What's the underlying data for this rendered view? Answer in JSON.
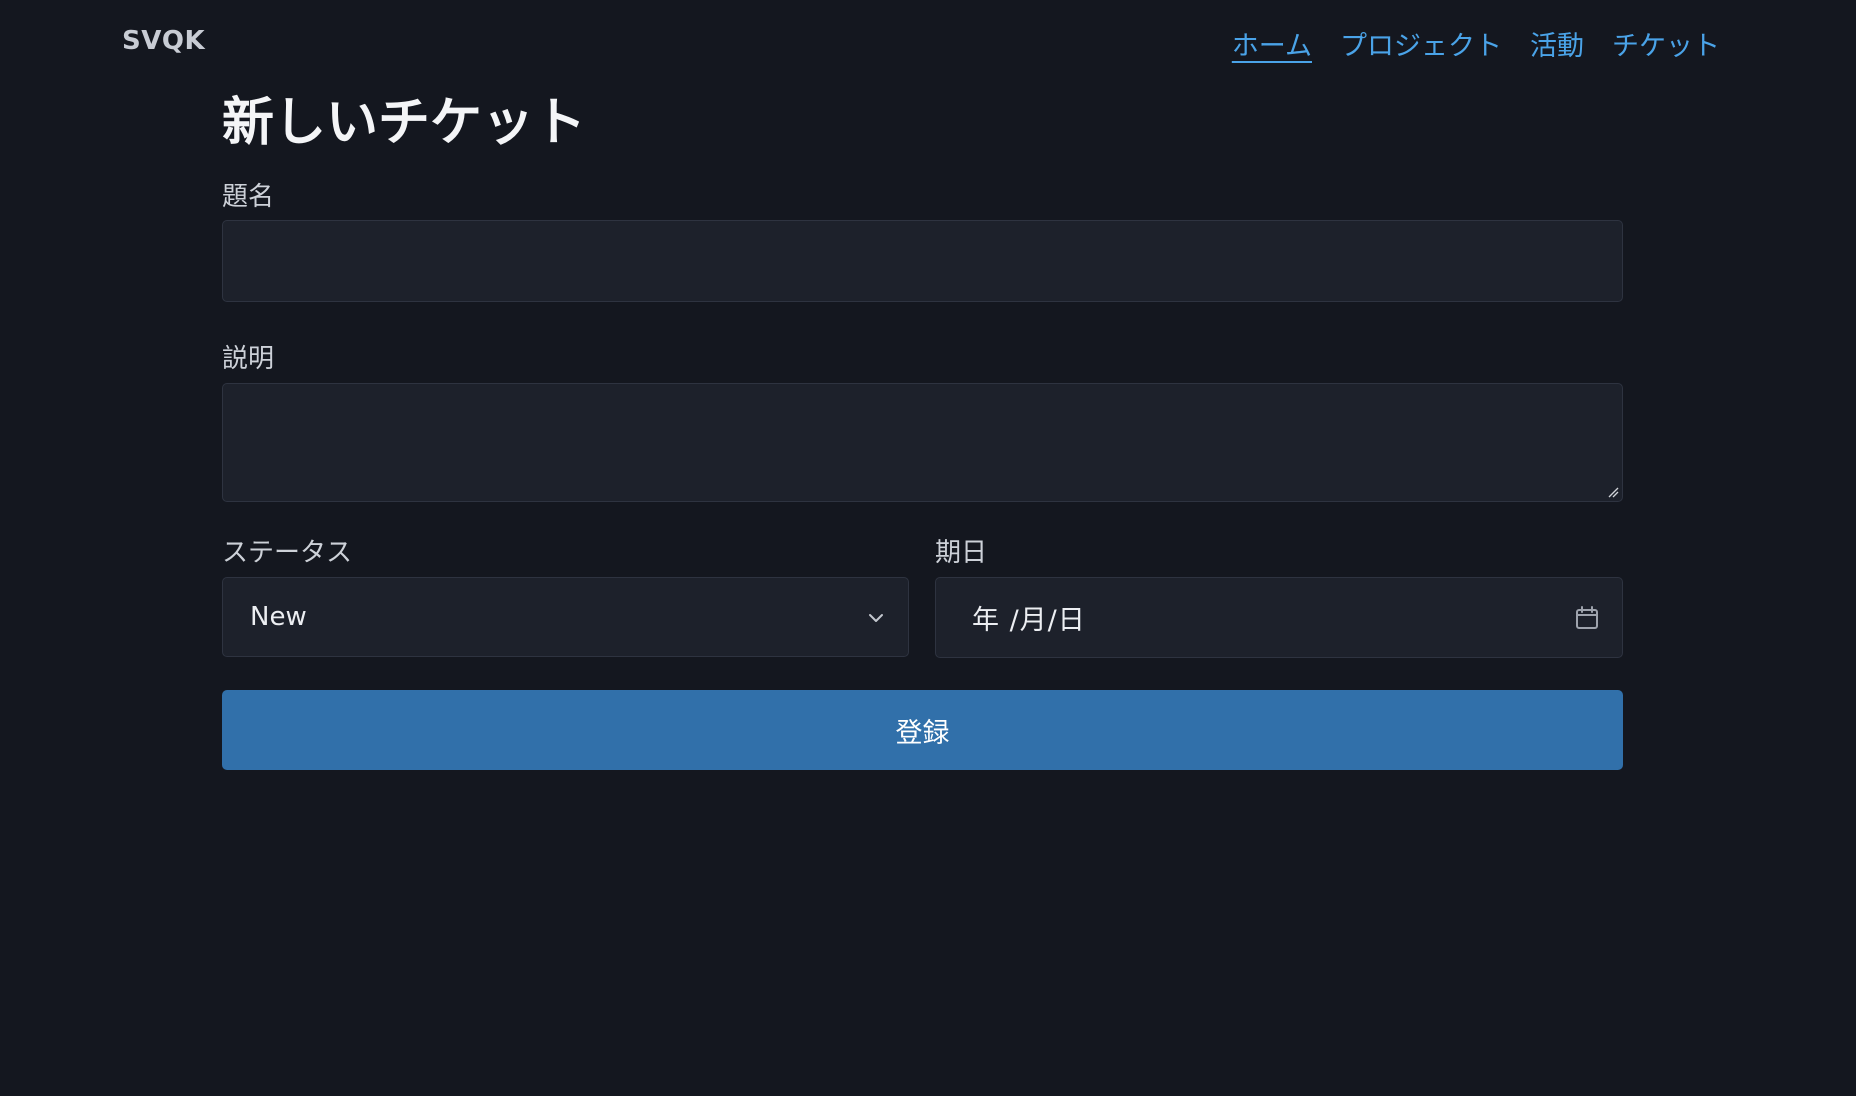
{
  "header": {
    "brand": "SVQK",
    "nav": [
      {
        "label": "ホーム",
        "active": true
      },
      {
        "label": "プロジェクト",
        "active": false
      },
      {
        "label": "活動",
        "active": false
      },
      {
        "label": "チケット",
        "active": false
      }
    ]
  },
  "page": {
    "title": "新しいチケット"
  },
  "form": {
    "subject": {
      "label": "題名",
      "value": ""
    },
    "description": {
      "label": "説明",
      "value": ""
    },
    "status": {
      "label": "ステータス",
      "value": "New",
      "icon": "chevron-down-icon"
    },
    "due_date": {
      "label": "期日",
      "value": "年 /月/日",
      "icon": "calendar-icon"
    },
    "submit_label": "登録"
  },
  "colors": {
    "background": "#14171f",
    "field_background": "#1d212b",
    "link": "#4aa3e8",
    "button": "#3170aa"
  }
}
